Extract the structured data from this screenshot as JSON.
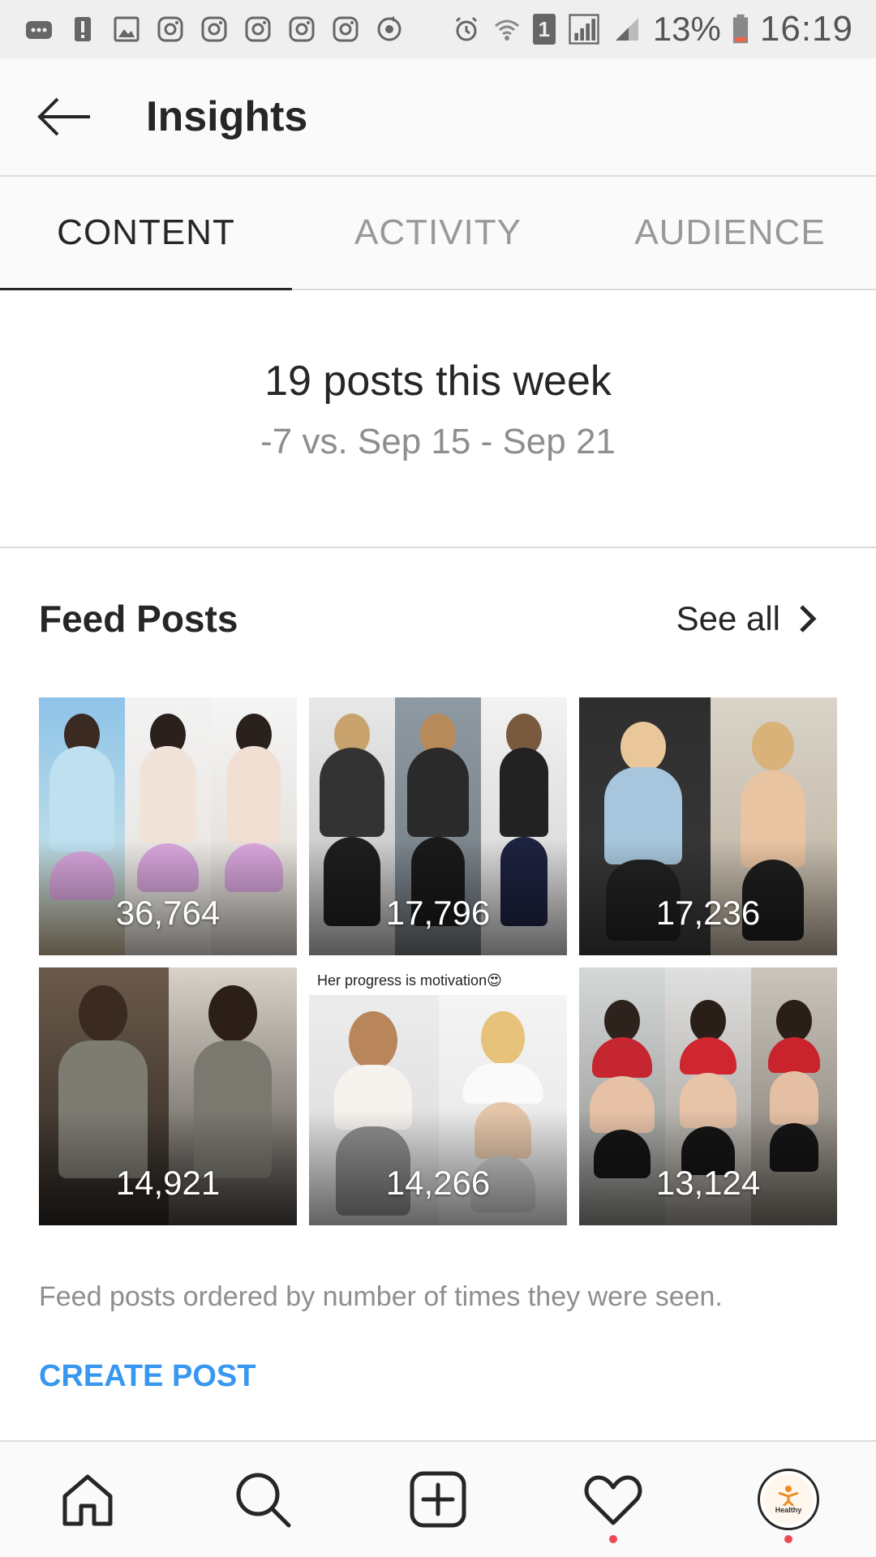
{
  "status_bar": {
    "battery": "13%",
    "time": "16:19",
    "sim_slot": "1",
    "icons": [
      "message-icon",
      "alert-icon",
      "image-icon",
      "instagram-icon",
      "instagram-icon",
      "instagram-icon",
      "instagram-icon",
      "instagram-icon",
      "sync-icon",
      "alarm-icon",
      "wifi-icon",
      "sim-icon",
      "signal-icon",
      "signal-icon",
      "battery-icon"
    ]
  },
  "header": {
    "title": "Insights"
  },
  "tabs": [
    {
      "label": "CONTENT",
      "active": true
    },
    {
      "label": "ACTIVITY",
      "active": false
    },
    {
      "label": "AUDIENCE",
      "active": false
    }
  ],
  "summary": {
    "title": "19 posts this week",
    "subtitle": "-7 vs. Sep 15 - Sep 21"
  },
  "feed_posts": {
    "title": "Feed Posts",
    "see_all": "See all",
    "posts": [
      {
        "count": "36,764",
        "caption": ""
      },
      {
        "count": "17,796",
        "caption": ""
      },
      {
        "count": "17,236",
        "caption": ""
      },
      {
        "count": "14,921",
        "caption": ""
      },
      {
        "count": "14,266",
        "caption": "Her progress is motivation😍"
      },
      {
        "count": "13,124",
        "caption": ""
      }
    ],
    "note": "Feed posts ordered by number of times they were seen.",
    "create_post": "CREATE POST"
  },
  "bottom_nav": {
    "items": [
      "home-icon",
      "search-icon",
      "new-post-icon",
      "activity-heart-icon",
      "profile-avatar"
    ],
    "profile_avatar_text": "Healthy"
  },
  "colors": {
    "accent": "#3897f0",
    "notification_dot": "#ed4956",
    "text_primary": "#262626",
    "text_secondary": "#8e8e8e"
  }
}
